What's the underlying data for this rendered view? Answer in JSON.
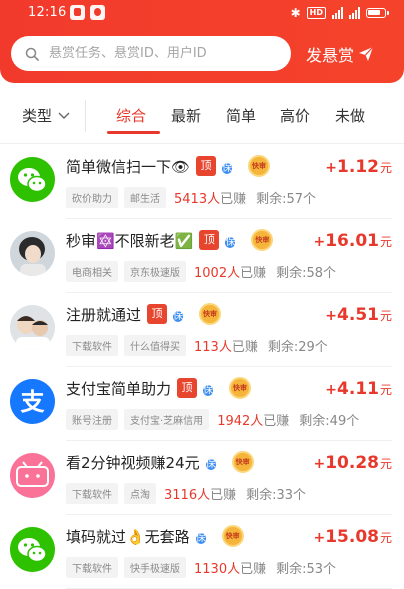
{
  "status_bar": {
    "time": "12:16",
    "network_badge": "HD",
    "battery_level": 0.8
  },
  "search": {
    "placeholder": "悬赏任务、悬赏ID、用户ID"
  },
  "header": {
    "post_label": "发悬赏"
  },
  "filter": {
    "type_label": "类型",
    "tabs": [
      {
        "label": "综合",
        "active": true
      },
      {
        "label": "最新",
        "active": false
      },
      {
        "label": "简单",
        "active": false
      },
      {
        "label": "高价",
        "active": false
      },
      {
        "label": "未做",
        "active": false
      }
    ]
  },
  "tag_labels": {
    "top": "顶",
    "guarantee": "保",
    "fast": "快审"
  },
  "tasks": [
    {
      "title": "简单微信扫一下👁",
      "tags": [
        "top",
        "guarantee",
        "fast"
      ],
      "reward": "1.12",
      "reward_plus": "+",
      "unit": "元",
      "categories": [
        "砍价助力",
        "邮生活"
      ],
      "earned_count": "5413人",
      "earned_suffix": "已赚",
      "remaining": "剩余:57个",
      "avatar": "wechat",
      "avatar_badge": ""
    },
    {
      "title": "秒审🔯不限新老✅",
      "tags": [
        "top",
        "guarantee",
        "fast"
      ],
      "reward": "16.01",
      "reward_plus": "+",
      "unit": "元",
      "categories": [
        "电商相关",
        "京东极速版"
      ],
      "earned_count": "1002人",
      "earned_suffix": "已赚",
      "remaining": "剩余:58个",
      "avatar": "photo-girl",
      "avatar_badge": ""
    },
    {
      "title": "注册就通过",
      "tags": [
        "top",
        "guarantee",
        "fast"
      ],
      "reward": "4.51",
      "reward_plus": "+",
      "unit": "元",
      "categories": [
        "下载软件",
        "什么值得买"
      ],
      "earned_count": "113人",
      "earned_suffix": "已赚",
      "remaining": "剩余:29个",
      "avatar": "photo-boy",
      "avatar_badge": ""
    },
    {
      "title": "支付宝简单助力",
      "tags": [
        "top",
        "guarantee",
        "fast"
      ],
      "reward": "4.11",
      "reward_plus": "+",
      "unit": "元",
      "categories": [
        "账号注册",
        "支付宝·芝麻信用"
      ],
      "earned_count": "1942人",
      "earned_suffix": "已赚",
      "remaining": "剩余:49个",
      "avatar": "alipay",
      "avatar_badge": ""
    },
    {
      "title": "看2分钟视频赚24元",
      "tags": [
        "guarantee",
        "fast"
      ],
      "reward": "10.28",
      "reward_plus": "+",
      "unit": "元",
      "categories": [
        "下载软件",
        "点淘"
      ],
      "earned_count": "3116人",
      "earned_suffix": "已赚",
      "remaining": "剩余:33个",
      "avatar": "bilibili",
      "avatar_badge": ""
    },
    {
      "title": "填码就过👌无套路",
      "tags": [
        "guarantee",
        "fast"
      ],
      "reward": "15.08",
      "reward_plus": "+",
      "unit": "元",
      "categories": [
        "下载软件",
        "快手极速版"
      ],
      "earned_count": "1130人",
      "earned_suffix": "已赚",
      "remaining": "剩余:53个",
      "avatar": "wechat",
      "avatar_badge": ""
    }
  ],
  "colors": {
    "accent": "#e8382b",
    "header": "#f23a2c",
    "guarantee": "#3d8ef0",
    "fast": "#f5b43a"
  }
}
